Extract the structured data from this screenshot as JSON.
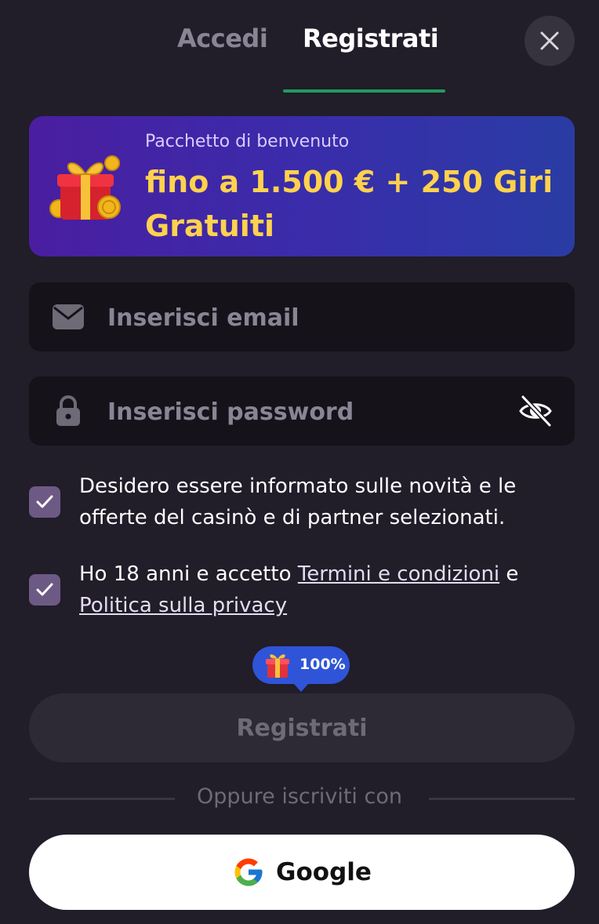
{
  "tabs": {
    "login": "Accedi",
    "register": "Registrati"
  },
  "banner": {
    "subtitle": "Pacchetto di benvenuto",
    "title": "fino a 1.500 € + 250 Giri Gratuiti"
  },
  "form": {
    "email_placeholder": "Inserisci email",
    "password_placeholder": "Inserisci password"
  },
  "consents": {
    "newsletter": {
      "checked": true,
      "text": "Desidero essere informato sulle novità e le offerte del casinò e di partner selezionati."
    },
    "terms": {
      "checked": true,
      "prefix": "Ho 18 anni e accetto",
      "terms_link": "Termini e condizioni",
      "conjunction": "e",
      "privacy_link": "Politica sulla privacy"
    }
  },
  "bonus_pill": {
    "label": "100%"
  },
  "submit_label": "Registrati",
  "divider_text": "Oppure iscriviti con",
  "google_label": "Google",
  "colors": {
    "background": "#211d29",
    "accent_green": "#1f9d5c",
    "banner_gold": "#ffd24d",
    "pill_blue": "#3054d8"
  }
}
